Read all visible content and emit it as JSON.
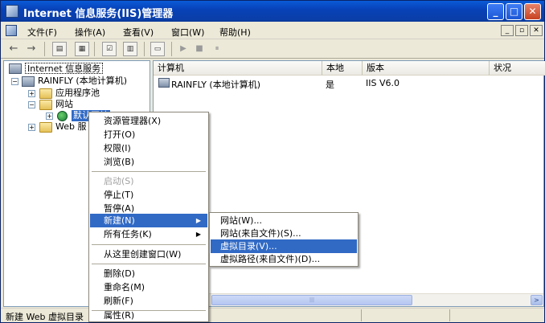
{
  "window": {
    "title": "Internet 信息服务(IIS)管理器",
    "controls": {
      "minimize": "_",
      "maximize": "□",
      "close": "✕"
    }
  },
  "menubar": {
    "items": [
      "文件(F)",
      "操作(A)",
      "查看(V)",
      "窗口(W)",
      "帮助(H)"
    ],
    "mdi_controls": [
      "_",
      "▫",
      "✕"
    ]
  },
  "toolbar": {
    "back": "←",
    "forward": "→",
    "play": "▶",
    "stop": "■",
    "pause": "⏸"
  },
  "tree": {
    "root": "Internet 信息服务",
    "computer": "RAINFLY (本地计算机)",
    "app_pools": "应用程序池",
    "websites": "网站",
    "default_site": "默认网站",
    "web_ext": "Web 服"
  },
  "list": {
    "columns": [
      "计算机",
      "本地",
      "版本",
      "状况"
    ],
    "rows": [
      {
        "computer": "RAINFLY (本地计算机)",
        "local": "是",
        "version": "IIS V6.0",
        "status": ""
      }
    ]
  },
  "context_menu": {
    "items": [
      "资源管理器(X)",
      "打开(O)",
      "权限(I)",
      "浏览(B)",
      "启动(S)",
      "停止(T)",
      "暂停(A)",
      "新建(N)",
      "所有任务(K)",
      "从这里创建窗口(W)",
      "删除(D)",
      "重命名(M)",
      "刷新(F)",
      "属性(R)"
    ],
    "submenu_arrow": "▶"
  },
  "submenu": {
    "items": [
      "网站(W)...",
      "网站(来自文件)(S)...",
      "虚拟目录(V)...",
      "虚拟路径(来自文件)(D)..."
    ],
    "highlighted_index": 2
  },
  "statusbar": {
    "text": "新建 Web 虚拟目录"
  },
  "scrollbar": {
    "grip": "|||",
    "right_arrow": ">"
  }
}
